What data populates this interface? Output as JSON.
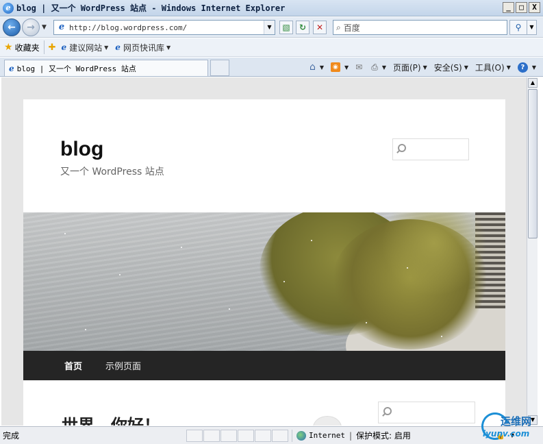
{
  "window": {
    "title": "blog | 又一个 WordPress 站点 - Windows Internet Explorer",
    "controls": {
      "minimize": "_",
      "maximize": "□",
      "close": "X"
    }
  },
  "navbar": {
    "url": "http://blog.wordpress.com/",
    "search_placeholder": "百度"
  },
  "favorites_bar": {
    "favorites_label": "收藏夹",
    "items": [
      {
        "label": "建议网站",
        "icon": "ie-page-icon"
      },
      {
        "label": "网页快讯库",
        "icon": "ie-page-icon"
      }
    ]
  },
  "tabs": [
    {
      "title": "blog | 又一个 WordPress 站点",
      "active": true
    }
  ],
  "command_bar": {
    "page": "页面(P)",
    "safety": "安全(S)",
    "tools": "工具(O)",
    "help": "?"
  },
  "site": {
    "title": "blog",
    "description": "又一个 WordPress 站点",
    "nav": [
      {
        "label": "首页",
        "current": true
      },
      {
        "label": "示例页面",
        "current": false
      }
    ],
    "post_title": "世界，你好！"
  },
  "statusbar": {
    "status": "完成",
    "zone": "Internet",
    "protected_mode": "保护模式: 启用"
  },
  "watermark": {
    "cn": "运维网",
    "en": "iyunv.com"
  },
  "colors": {
    "titlebar": "#c3d5ea",
    "wp_nav_bg": "#252525",
    "accent_blue": "#1d5ca8"
  }
}
